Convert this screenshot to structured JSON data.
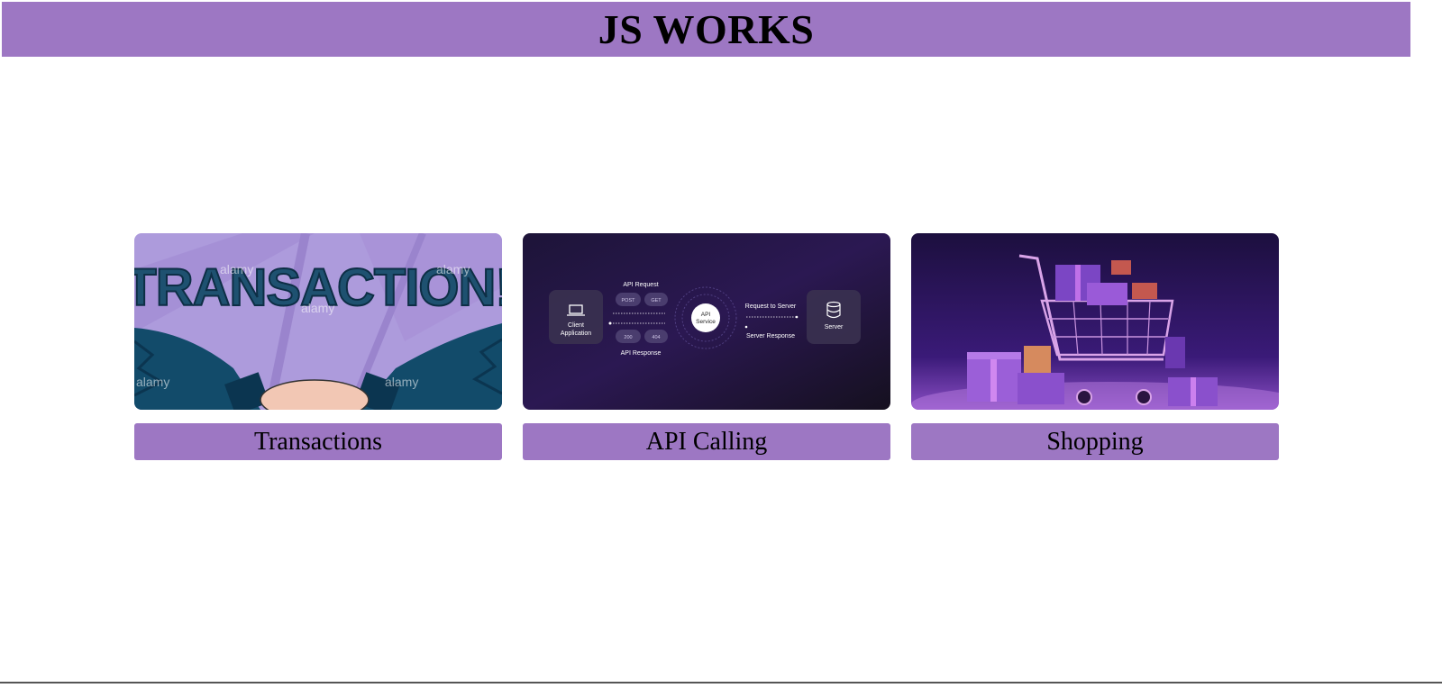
{
  "header": {
    "title": "JS WORKS"
  },
  "cards": [
    {
      "label": "Transactions",
      "image": {
        "text": "TRANSACTION!",
        "watermark": "alamy"
      }
    },
    {
      "label": "API Calling",
      "image": {
        "client_title": "Client",
        "client_subtitle": "Application",
        "api_request": "API Request",
        "post": "POST",
        "get": "GET",
        "code_200": "200",
        "code_404": "404",
        "api_response": "API Response",
        "service_title": "API",
        "service_subtitle": "Service",
        "request_to_server": "Request to Server",
        "server_response": "Server Response",
        "server": "Server"
      }
    },
    {
      "label": "Shopping",
      "image": {}
    }
  ],
  "colors": {
    "accent": "#9d77c3"
  }
}
